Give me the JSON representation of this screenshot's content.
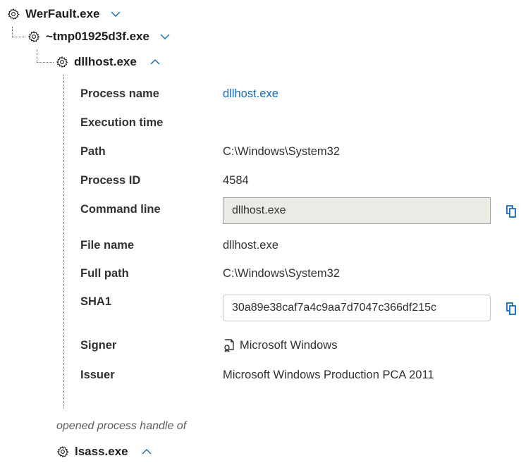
{
  "tree": {
    "root": {
      "label": "WerFault.exe",
      "icon": "gear-icon",
      "expander": "chevron-down-icon"
    },
    "child": {
      "label": "~tmp01925d3f.exe",
      "icon": "gear-icon",
      "expander": "chevron-down-icon"
    },
    "grandchild": {
      "label": "dllhost.exe",
      "icon": "gear-icon",
      "expander": "chevron-up-icon"
    }
  },
  "details": {
    "process_name": {
      "label": "Process name",
      "value": "dllhost.exe"
    },
    "execution_time": {
      "label": "Execution time",
      "value": ""
    },
    "path": {
      "label": "Path",
      "value": "C:\\Windows\\System32"
    },
    "process_id": {
      "label": "Process ID",
      "value": "4584"
    },
    "command_line": {
      "label": "Command line",
      "value": "dllhost.exe"
    },
    "file_name": {
      "label": "File name",
      "value": "dllhost.exe"
    },
    "full_path": {
      "label": "Full path",
      "value": "C:\\Windows\\System32"
    },
    "sha1": {
      "label": "SHA1",
      "value": "30a89e38caf7a4c9aa7d7047c366df215c"
    },
    "signer": {
      "label": "Signer",
      "value": "Microsoft Windows",
      "icon": "certificate-icon"
    },
    "issuer": {
      "label": "Issuer",
      "value": "Microsoft Windows Production PCA 2011"
    }
  },
  "relation": {
    "text": "opened process handle of"
  },
  "target": {
    "label": "lsass.exe",
    "icon": "gear-icon",
    "expander": "chevron-up-icon"
  },
  "colors": {
    "link": "#0f6cbd",
    "disabled_field_bg": "#ebebe5",
    "text": "#201f1e",
    "muted": "#605e5c"
  }
}
